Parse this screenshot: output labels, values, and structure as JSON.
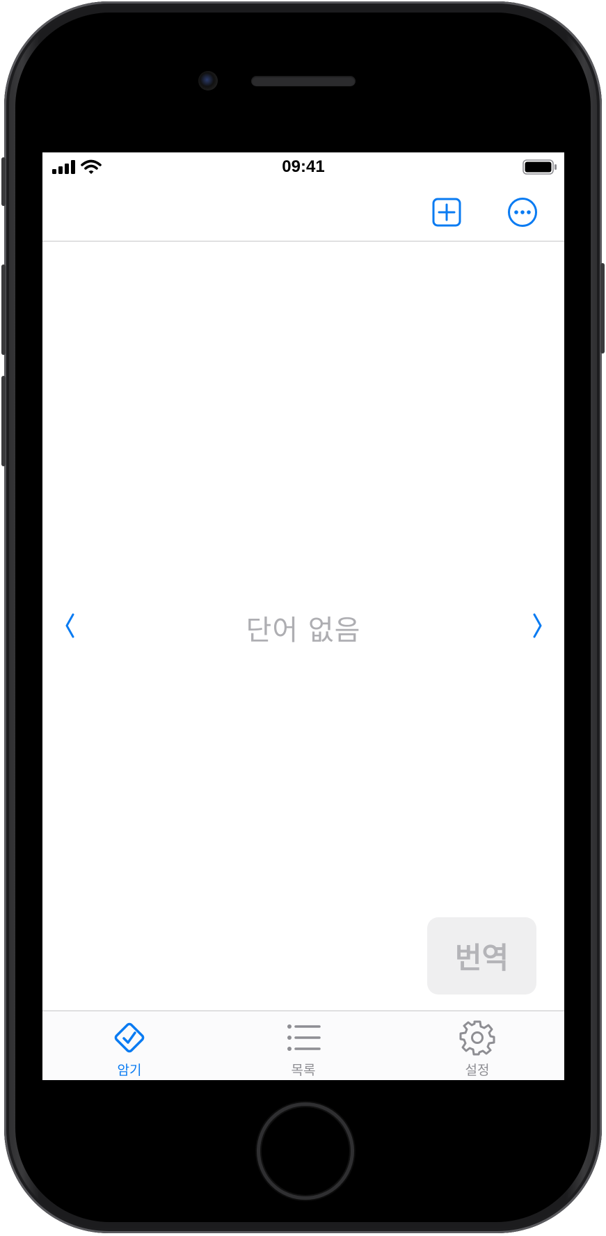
{
  "status_bar": {
    "time": "09:41",
    "signal_icon": "cellular-signal-icon",
    "wifi_icon": "wifi-icon",
    "battery_icon": "battery-full-icon"
  },
  "nav_bar": {
    "add_icon": "plus-square-icon",
    "more_icon": "ellipsis-circle-icon"
  },
  "main": {
    "empty_text": "단어 없음",
    "prev_icon": "chevron-left-icon",
    "next_icon": "chevron-right-icon",
    "translate_label": "번역"
  },
  "tab_bar": {
    "tabs": [
      {
        "label": "암기",
        "icon": "checkmark-diamond-icon",
        "active": true
      },
      {
        "label": "목록",
        "icon": "list-bullet-icon",
        "active": false
      },
      {
        "label": "설정",
        "icon": "gear-icon",
        "active": false
      }
    ]
  },
  "colors": {
    "accent": "#0a7bf2",
    "inactive": "#8e8e93",
    "placeholder_text": "#aeaeb2",
    "disabled_button_bg": "#efeff0",
    "disabled_button_text": "#b4b4b8"
  }
}
